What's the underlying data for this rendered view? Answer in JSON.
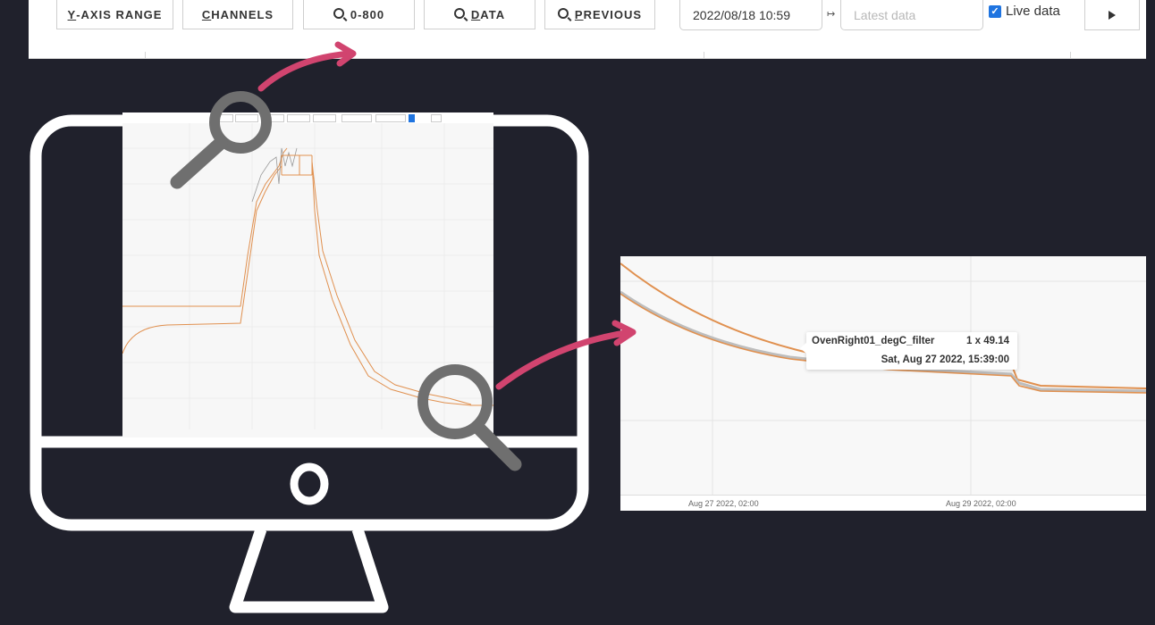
{
  "toolbar": {
    "buttons": [
      {
        "prefix": "",
        "underline": "Y",
        "rest": "-AXIS RANGE",
        "icon": null
      },
      {
        "prefix": "",
        "underline": "C",
        "rest": "HANNELS",
        "icon": null
      },
      {
        "prefix": "",
        "underline": "",
        "rest": "0-800",
        "icon": "search-icon"
      },
      {
        "prefix": "",
        "underline": "D",
        "rest": "ATA",
        "icon": "search-icon"
      },
      {
        "prefix": "",
        "underline": "P",
        "rest": "REVIOUS",
        "icon": "search-icon"
      }
    ],
    "start_time": "2022/08/18 10:59",
    "range_arrow": "↦",
    "end_time_placeholder": "Latest data",
    "live_data_label": "Live data",
    "live_data_checked": true,
    "play_icon": "play-icon"
  },
  "zoom_panel": {
    "tooltip": {
      "series": "OvenRight01_degC_filter",
      "value": "1 x 49.14",
      "timestamp": "Sat, Aug 27 2022, 15:39:00"
    },
    "x_ticks": [
      "Aug 27 2022, 02:00",
      "Aug 29 2022, 02:00"
    ]
  },
  "colors": {
    "background": "#20212c",
    "accent_arrow": "#d1446f",
    "series_orange": "#e0904f",
    "series_gray": "#999999",
    "magnifier": "#6f6f6f",
    "checkbox": "#1f74e0"
  },
  "illustration": {
    "monitor_icon": "monitor-icon",
    "magnifier_icons": [
      "magnifier-icon-top",
      "magnifier-icon-bottom"
    ],
    "arrows": [
      "arrow-to-toolbar",
      "arrow-to-zoom"
    ]
  }
}
